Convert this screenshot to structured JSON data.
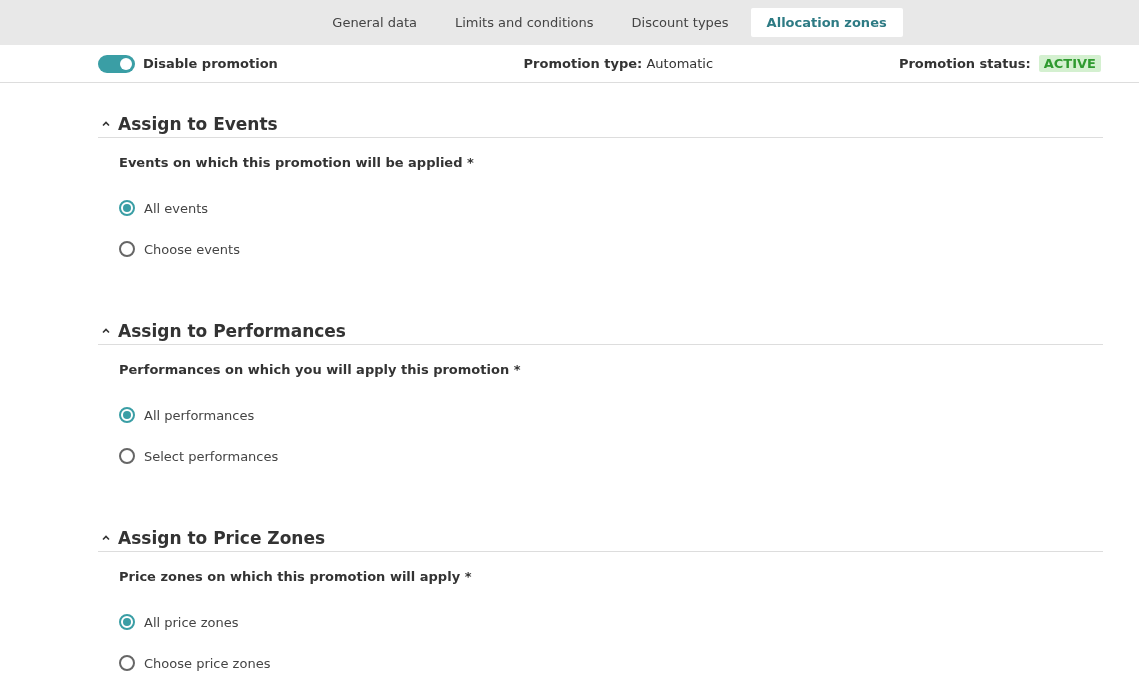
{
  "tabs": [
    {
      "label": "General data",
      "selected": false
    },
    {
      "label": "Limits and conditions",
      "selected": false
    },
    {
      "label": "Discount types",
      "selected": false
    },
    {
      "label": "Allocation zones",
      "selected": true
    }
  ],
  "status_bar": {
    "toggle": {
      "label": "Disable promotion",
      "on": true
    },
    "type_label": "Promotion type:",
    "type_value": "Automatic",
    "status_label": "Promotion status:",
    "status_value": "ACTIVE"
  },
  "sections": [
    {
      "title": "Assign to Events",
      "expanded": true,
      "question": "Events on which this promotion will be applied *",
      "options": [
        {
          "label": "All events",
          "selected": true
        },
        {
          "label": "Choose events",
          "selected": false
        }
      ]
    },
    {
      "title": "Assign to Performances",
      "expanded": true,
      "question": "Performances on which you will apply this promotion *",
      "options": [
        {
          "label": "All performances",
          "selected": true
        },
        {
          "label": "Select performances",
          "selected": false
        }
      ]
    },
    {
      "title": "Assign to Price Zones",
      "expanded": true,
      "question": "Price zones on which this promotion will apply *",
      "options": [
        {
          "label": "All price zones",
          "selected": true
        },
        {
          "label": "Choose price zones",
          "selected": false
        }
      ]
    }
  ]
}
